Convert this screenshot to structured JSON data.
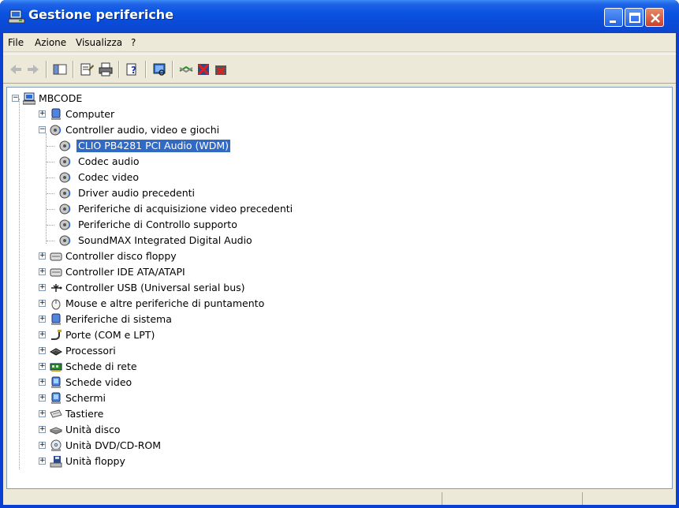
{
  "window": {
    "title": "Gestione periferiche"
  },
  "menu": [
    "File",
    "Azione",
    "Visualizza",
    "?"
  ],
  "toolbar": {
    "buttons": [
      "back-icon",
      "forward-icon",
      "show-hide-console-tree-icon",
      "properties-icon",
      "print-icon",
      "help-icon",
      "scan-hardware-icon",
      "update-driver-icon",
      "disable-device-icon",
      "uninstall-device-icon"
    ]
  },
  "tree": {
    "root": "MBCODE",
    "computer": "Computer",
    "audio_category": "Controller audio, video e giochi",
    "audio_children": [
      "CLIO PB4281 PCI Audio (WDM)",
      "Codec audio",
      "Codec video",
      "Driver audio precedenti",
      "Periferiche di acquisizione video precedenti",
      "Periferiche di Controllo supporto",
      "SoundMAX Integrated Digital Audio"
    ],
    "categories": [
      "Controller disco floppy",
      "Controller IDE ATA/ATAPI",
      "Controller USB (Universal serial bus)",
      "Mouse e altre periferiche di puntamento",
      "Periferiche di sistema",
      "Porte (COM e LPT)",
      "Processori",
      "Schede di rete",
      "Schede video",
      "Schermi",
      "Tastiere",
      "Unità disco",
      "Unità DVD/CD-ROM",
      "Unità floppy"
    ]
  },
  "colors": {
    "titlebar": "#0a4bd8",
    "selection": "#316ac5",
    "chrome": "#ece9d8"
  }
}
